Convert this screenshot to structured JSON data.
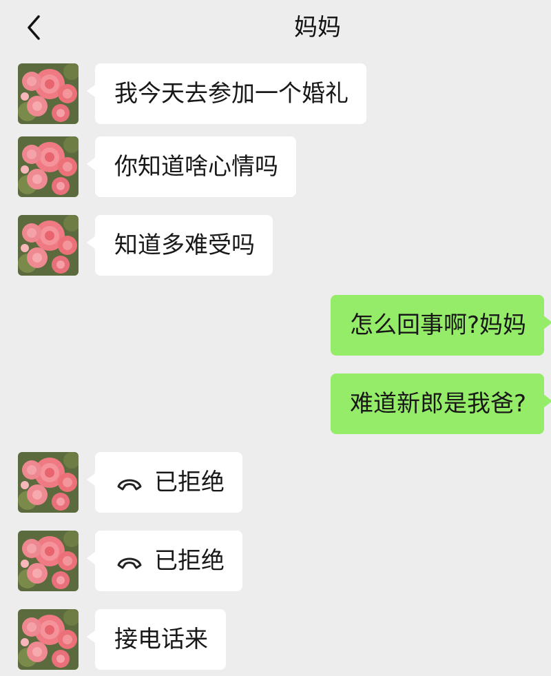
{
  "header": {
    "title": "妈妈",
    "back_icon": "chevron-left-icon"
  },
  "contact": {
    "avatar_icon": "pink-roses-avatar"
  },
  "messages": [
    {
      "side": "in",
      "type": "text",
      "text": "我今天去参加一个婚礼"
    },
    {
      "side": "in",
      "type": "text",
      "text": "你知道啥心情吗"
    },
    {
      "side": "in",
      "type": "text",
      "text": "知道多难受吗"
    },
    {
      "side": "out",
      "type": "text",
      "text": "怎么回事啊?妈妈"
    },
    {
      "side": "out",
      "type": "text",
      "text": "难道新郎是我爸?"
    },
    {
      "side": "in",
      "type": "call",
      "icon": "declined-call-icon",
      "text": "已拒绝"
    },
    {
      "side": "in",
      "type": "call",
      "icon": "declined-call-icon",
      "text": "已拒绝"
    },
    {
      "side": "in",
      "type": "text",
      "text": "接电话来"
    }
  ],
  "colors": {
    "background": "#ededed",
    "incoming_bubble": "#ffffff",
    "outgoing_bubble": "#95ec69",
    "text": "#181818"
  }
}
